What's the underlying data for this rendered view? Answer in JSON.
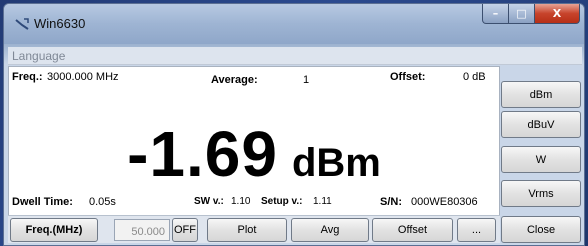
{
  "window": {
    "title": "Win6630",
    "min_glyph": "–",
    "max_glyph": "□",
    "close_glyph": "X"
  },
  "menu": {
    "items": [
      {
        "label": "Language"
      }
    ]
  },
  "readout": {
    "freq_label": "Freq.:",
    "freq_value": "3000.000 MHz",
    "average_label": "Average:",
    "average_value": "1",
    "offset_label": "Offset:",
    "offset_value": "0 dB",
    "measurement_value": "-1.69",
    "measurement_unit": "dBm",
    "dwell_label": "Dwell Time:",
    "dwell_value": "0.05s",
    "sw_label": "SW v.:",
    "sw_value": "1.10",
    "setup_label": "Setup v.:",
    "setup_value": "1.11",
    "sn_label": "S/N:",
    "sn_value": "000WE80306"
  },
  "units": {
    "buttons": [
      "dBm",
      "dBuV",
      "W",
      "Vrms"
    ]
  },
  "controls": {
    "freq_label": "Freq.(MHz)",
    "freq_input_value": "50.000",
    "off_label": "OFF",
    "plot_label": "Plot",
    "avg_label": "Avg",
    "offset_label": "Offset",
    "more_label": "...",
    "close_label": "Close"
  }
}
